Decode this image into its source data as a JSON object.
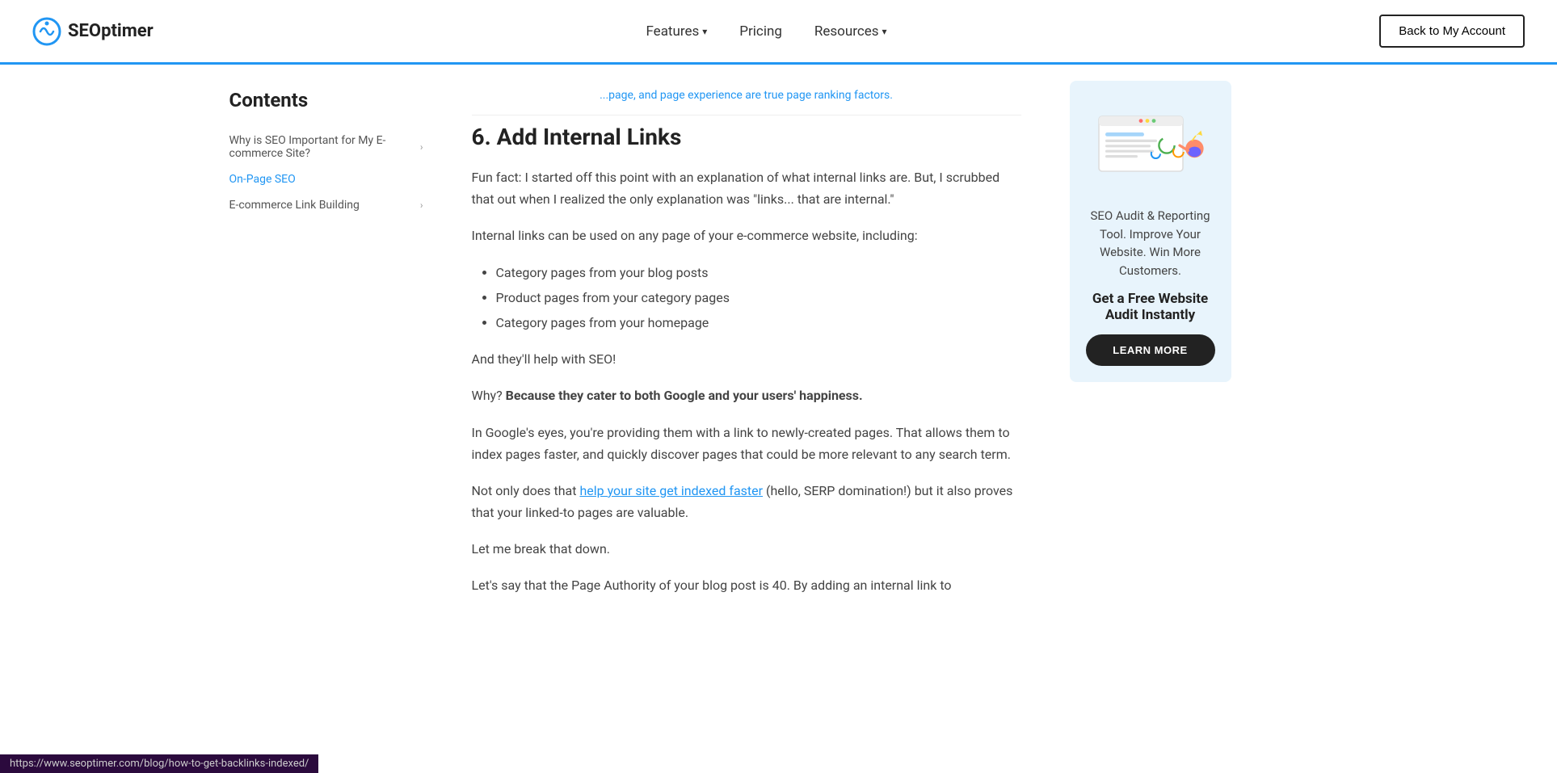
{
  "header": {
    "logo_text": "SEOptimer",
    "nav": {
      "features_label": "Features",
      "pricing_label": "Pricing",
      "resources_label": "Resources"
    },
    "back_button_label": "Back to My Account"
  },
  "sidebar": {
    "title": "Contents",
    "items": [
      {
        "label": "Why is SEO Important for My E-commerce Site?",
        "active": false,
        "has_arrow": true
      },
      {
        "label": "On-Page SEO",
        "active": true,
        "has_arrow": false
      },
      {
        "label": "E-commerce Link Building",
        "active": false,
        "has_arrow": true
      }
    ]
  },
  "partial_top_text": "...page, and page experience are true page ranking factors.",
  "section": {
    "heading": "6. Add Internal Links",
    "paragraphs": [
      {
        "type": "text",
        "content": "Fun fact: I started off this point with an explanation of what internal links are. But, I scrubbed that out when I realized the only explanation was \"links... that are internal.\""
      },
      {
        "type": "text",
        "content": "Internal links can be used on any page of your e-commerce website, including:"
      },
      {
        "type": "list",
        "items": [
          "Category pages from your blog posts",
          "Product pages from your category pages",
          "Category pages from your homepage"
        ]
      },
      {
        "type": "text",
        "content": "And they'll help with SEO!"
      },
      {
        "type": "mixed",
        "before": "Why? ",
        "bold": "Because they cater to both Google and your users' happiness."
      },
      {
        "type": "text",
        "content": "In Google's eyes, you're providing them with a link to newly-created pages. That allows them to index pages faster, and quickly discover pages that could be more relevant to any search term."
      },
      {
        "type": "mixed_link",
        "before": "Not only does that ",
        "link_text": "help your site get indexed faster",
        "after": " (hello, SERP domination!) but it also proves that your linked-to pages are valuable."
      },
      {
        "type": "text",
        "content": "Let me break that down."
      },
      {
        "type": "text",
        "content": "Let's say that the Page Authority of your blog post is 40. By adding an internal link to"
      }
    ]
  },
  "audit_card": {
    "description": "SEO Audit & Reporting Tool. Improve Your Website. Win More Customers.",
    "cta_title": "Get a Free Website Audit Instantly",
    "button_label": "LEARN MORE"
  },
  "status_bar": {
    "url": "https://www.seoptimer.com/blog/how-to-get-backlinks-indexed/"
  }
}
